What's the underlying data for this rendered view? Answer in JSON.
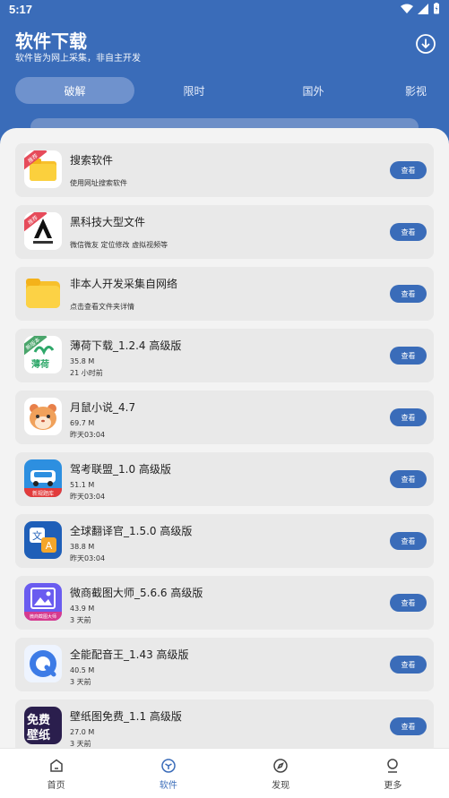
{
  "status": {
    "time": "5:17"
  },
  "header": {
    "title": "软件下载",
    "subtitle": "软件皆为网上采集，非自主开发"
  },
  "tabs": [
    {
      "label": "破解"
    },
    {
      "label": "限时"
    },
    {
      "label": "国外"
    },
    {
      "label": "影视"
    }
  ],
  "list": [
    {
      "title": "搜索软件",
      "line1": "使用网址搜索软件",
      "line2": "",
      "badge": "推荐",
      "icon": "folder-icon",
      "button": "查看"
    },
    {
      "title": "黑科技大型文件",
      "line1": "微信微友 定位修改 虚拟视频等",
      "line2": "",
      "badge": "推荐",
      "icon": "black-tech-icon",
      "button": "查看"
    },
    {
      "title": "非本人开发采集自网络",
      "line1": "点击查看文件夹详情",
      "line2": "",
      "badge": "",
      "icon": "folder-icon",
      "button": "查看"
    },
    {
      "title": "薄荷下载_1.2.4 高级版",
      "line1": "35.8 M",
      "line2": "21 小时前",
      "badge": "新版本",
      "icon": "mint-icon",
      "button": "查看"
    },
    {
      "title": "月鼠小说_4.7",
      "line1": "69.7 M",
      "line2": "昨天03:04",
      "badge": "",
      "icon": "hamster-icon",
      "button": "查看"
    },
    {
      "title": "驾考联盟_1.0 高级版",
      "line1": "51.1 M",
      "line2": "昨天03:04",
      "badge": "",
      "icon": "car-icon",
      "button": "查看"
    },
    {
      "title": "全球翻译官_1.5.0 高级版",
      "line1": "38.8 M",
      "line2": "昨天03:04",
      "badge": "",
      "icon": "translate-icon",
      "button": "查看"
    },
    {
      "title": "微商截图大师_5.6.6 高级版",
      "line1": "43.9 M",
      "line2": "3 天前",
      "badge": "",
      "icon": "screenshot-icon",
      "button": "查看"
    },
    {
      "title": "全能配音王_1.43 高级版",
      "line1": "40.5 M",
      "line2": "3 天前",
      "badge": "",
      "icon": "dubbing-icon",
      "button": "查看"
    },
    {
      "title": "壁纸图免费_1.1 高级版",
      "line1": "27.0 M",
      "line2": "3 天前",
      "badge": "",
      "icon": "wallpaper-icon",
      "button": "查看"
    }
  ],
  "thumb_text": {
    "car_banner": "新规题库",
    "screenshot_banner": "微商截图大师",
    "wallpaper_top": "免费",
    "wallpaper_bottom": "壁纸",
    "mint": "薄荷"
  },
  "nav": [
    {
      "label": "首页",
      "icon": "home-icon"
    },
    {
      "label": "软件",
      "icon": "box-icon"
    },
    {
      "label": "发现",
      "icon": "compass-icon"
    },
    {
      "label": "更多",
      "icon": "user-icon"
    }
  ],
  "colors": {
    "primary": "#3a6cb9",
    "badge_red": "#e64b5a",
    "card_bg": "#e9e9e9"
  }
}
